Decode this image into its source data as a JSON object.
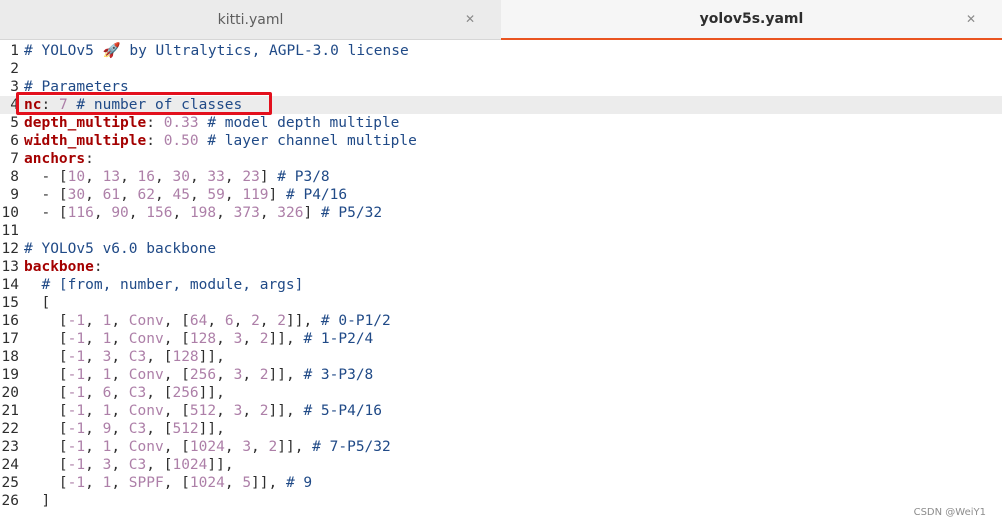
{
  "tabs": [
    {
      "label": "kitti.yaml",
      "active": false,
      "close_glyph": "✕"
    },
    {
      "label": "yolov5s.yaml",
      "active": true,
      "close_glyph": "✕"
    }
  ],
  "editor": {
    "current_line": 4,
    "highlighted_line": 4,
    "lines": [
      {
        "num": "1",
        "tokens": [
          {
            "t": "c",
            "v": "# YOLOv5 🚀 by Ultralytics, AGPL-3.0 license"
          }
        ]
      },
      {
        "num": "2",
        "tokens": []
      },
      {
        "num": "3",
        "tokens": [
          {
            "t": "c",
            "v": "# Parameters"
          }
        ]
      },
      {
        "num": "4",
        "tokens": [
          {
            "t": "k",
            "v": "nc"
          },
          {
            "t": "p",
            "v": ": "
          },
          {
            "t": "n",
            "v": "7"
          },
          {
            "t": "p",
            "v": " "
          },
          {
            "t": "c",
            "v": "# number of classes"
          }
        ]
      },
      {
        "num": "5",
        "tokens": [
          {
            "t": "k",
            "v": "depth_multiple"
          },
          {
            "t": "p",
            "v": ": "
          },
          {
            "t": "n",
            "v": "0.33"
          },
          {
            "t": "p",
            "v": " "
          },
          {
            "t": "c",
            "v": "# model depth multiple"
          }
        ]
      },
      {
        "num": "6",
        "tokens": [
          {
            "t": "k",
            "v": "width_multiple"
          },
          {
            "t": "p",
            "v": ": "
          },
          {
            "t": "n",
            "v": "0.50"
          },
          {
            "t": "p",
            "v": " "
          },
          {
            "t": "c",
            "v": "# layer channel multiple"
          }
        ]
      },
      {
        "num": "7",
        "tokens": [
          {
            "t": "k",
            "v": "anchors"
          },
          {
            "t": "p",
            "v": ":"
          }
        ]
      },
      {
        "num": "8",
        "tokens": [
          {
            "t": "p",
            "v": "  - ["
          },
          {
            "t": "n",
            "v": "10"
          },
          {
            "t": "p",
            "v": ", "
          },
          {
            "t": "n",
            "v": "13"
          },
          {
            "t": "p",
            "v": ", "
          },
          {
            "t": "n",
            "v": "16"
          },
          {
            "t": "p",
            "v": ", "
          },
          {
            "t": "n",
            "v": "30"
          },
          {
            "t": "p",
            "v": ", "
          },
          {
            "t": "n",
            "v": "33"
          },
          {
            "t": "p",
            "v": ", "
          },
          {
            "t": "n",
            "v": "23"
          },
          {
            "t": "p",
            "v": "] "
          },
          {
            "t": "c",
            "v": "# P3/8"
          }
        ]
      },
      {
        "num": "9",
        "tokens": [
          {
            "t": "p",
            "v": "  - ["
          },
          {
            "t": "n",
            "v": "30"
          },
          {
            "t": "p",
            "v": ", "
          },
          {
            "t": "n",
            "v": "61"
          },
          {
            "t": "p",
            "v": ", "
          },
          {
            "t": "n",
            "v": "62"
          },
          {
            "t": "p",
            "v": ", "
          },
          {
            "t": "n",
            "v": "45"
          },
          {
            "t": "p",
            "v": ", "
          },
          {
            "t": "n",
            "v": "59"
          },
          {
            "t": "p",
            "v": ", "
          },
          {
            "t": "n",
            "v": "119"
          },
          {
            "t": "p",
            "v": "] "
          },
          {
            "t": "c",
            "v": "# P4/16"
          }
        ]
      },
      {
        "num": "10",
        "tokens": [
          {
            "t": "p",
            "v": "  - ["
          },
          {
            "t": "n",
            "v": "116"
          },
          {
            "t": "p",
            "v": ", "
          },
          {
            "t": "n",
            "v": "90"
          },
          {
            "t": "p",
            "v": ", "
          },
          {
            "t": "n",
            "v": "156"
          },
          {
            "t": "p",
            "v": ", "
          },
          {
            "t": "n",
            "v": "198"
          },
          {
            "t": "p",
            "v": ", "
          },
          {
            "t": "n",
            "v": "373"
          },
          {
            "t": "p",
            "v": ", "
          },
          {
            "t": "n",
            "v": "326"
          },
          {
            "t": "p",
            "v": "] "
          },
          {
            "t": "c",
            "v": "# P5/32"
          }
        ]
      },
      {
        "num": "11",
        "tokens": []
      },
      {
        "num": "12",
        "tokens": [
          {
            "t": "c",
            "v": "# YOLOv5 v6.0 backbone"
          }
        ]
      },
      {
        "num": "13",
        "tokens": [
          {
            "t": "k",
            "v": "backbone"
          },
          {
            "t": "p",
            "v": ":"
          }
        ]
      },
      {
        "num": "14",
        "tokens": [
          {
            "t": "p",
            "v": "  "
          },
          {
            "t": "c",
            "v": "# [from, number, module, args]"
          }
        ]
      },
      {
        "num": "15",
        "tokens": [
          {
            "t": "p",
            "v": "  ["
          }
        ]
      },
      {
        "num": "16",
        "tokens": [
          {
            "t": "p",
            "v": "    ["
          },
          {
            "t": "n",
            "v": "-1"
          },
          {
            "t": "p",
            "v": ", "
          },
          {
            "t": "n",
            "v": "1"
          },
          {
            "t": "p",
            "v": ", "
          },
          {
            "t": "n",
            "v": "Conv"
          },
          {
            "t": "p",
            "v": ", ["
          },
          {
            "t": "n",
            "v": "64"
          },
          {
            "t": "p",
            "v": ", "
          },
          {
            "t": "n",
            "v": "6"
          },
          {
            "t": "p",
            "v": ", "
          },
          {
            "t": "n",
            "v": "2"
          },
          {
            "t": "p",
            "v": ", "
          },
          {
            "t": "n",
            "v": "2"
          },
          {
            "t": "p",
            "v": "]], "
          },
          {
            "t": "c",
            "v": "# 0-P1/2"
          }
        ]
      },
      {
        "num": "17",
        "tokens": [
          {
            "t": "p",
            "v": "    ["
          },
          {
            "t": "n",
            "v": "-1"
          },
          {
            "t": "p",
            "v": ", "
          },
          {
            "t": "n",
            "v": "1"
          },
          {
            "t": "p",
            "v": ", "
          },
          {
            "t": "n",
            "v": "Conv"
          },
          {
            "t": "p",
            "v": ", ["
          },
          {
            "t": "n",
            "v": "128"
          },
          {
            "t": "p",
            "v": ", "
          },
          {
            "t": "n",
            "v": "3"
          },
          {
            "t": "p",
            "v": ", "
          },
          {
            "t": "n",
            "v": "2"
          },
          {
            "t": "p",
            "v": "]], "
          },
          {
            "t": "c",
            "v": "# 1-P2/4"
          }
        ]
      },
      {
        "num": "18",
        "tokens": [
          {
            "t": "p",
            "v": "    ["
          },
          {
            "t": "n",
            "v": "-1"
          },
          {
            "t": "p",
            "v": ", "
          },
          {
            "t": "n",
            "v": "3"
          },
          {
            "t": "p",
            "v": ", "
          },
          {
            "t": "n",
            "v": "C3"
          },
          {
            "t": "p",
            "v": ", ["
          },
          {
            "t": "n",
            "v": "128"
          },
          {
            "t": "p",
            "v": "]],"
          }
        ]
      },
      {
        "num": "19",
        "tokens": [
          {
            "t": "p",
            "v": "    ["
          },
          {
            "t": "n",
            "v": "-1"
          },
          {
            "t": "p",
            "v": ", "
          },
          {
            "t": "n",
            "v": "1"
          },
          {
            "t": "p",
            "v": ", "
          },
          {
            "t": "n",
            "v": "Conv"
          },
          {
            "t": "p",
            "v": ", ["
          },
          {
            "t": "n",
            "v": "256"
          },
          {
            "t": "p",
            "v": ", "
          },
          {
            "t": "n",
            "v": "3"
          },
          {
            "t": "p",
            "v": ", "
          },
          {
            "t": "n",
            "v": "2"
          },
          {
            "t": "p",
            "v": "]], "
          },
          {
            "t": "c",
            "v": "# 3-P3/8"
          }
        ]
      },
      {
        "num": "20",
        "tokens": [
          {
            "t": "p",
            "v": "    ["
          },
          {
            "t": "n",
            "v": "-1"
          },
          {
            "t": "p",
            "v": ", "
          },
          {
            "t": "n",
            "v": "6"
          },
          {
            "t": "p",
            "v": ", "
          },
          {
            "t": "n",
            "v": "C3"
          },
          {
            "t": "p",
            "v": ", ["
          },
          {
            "t": "n",
            "v": "256"
          },
          {
            "t": "p",
            "v": "]],"
          }
        ]
      },
      {
        "num": "21",
        "tokens": [
          {
            "t": "p",
            "v": "    ["
          },
          {
            "t": "n",
            "v": "-1"
          },
          {
            "t": "p",
            "v": ", "
          },
          {
            "t": "n",
            "v": "1"
          },
          {
            "t": "p",
            "v": ", "
          },
          {
            "t": "n",
            "v": "Conv"
          },
          {
            "t": "p",
            "v": ", ["
          },
          {
            "t": "n",
            "v": "512"
          },
          {
            "t": "p",
            "v": ", "
          },
          {
            "t": "n",
            "v": "3"
          },
          {
            "t": "p",
            "v": ", "
          },
          {
            "t": "n",
            "v": "2"
          },
          {
            "t": "p",
            "v": "]], "
          },
          {
            "t": "c",
            "v": "# 5-P4/16"
          }
        ]
      },
      {
        "num": "22",
        "tokens": [
          {
            "t": "p",
            "v": "    ["
          },
          {
            "t": "n",
            "v": "-1"
          },
          {
            "t": "p",
            "v": ", "
          },
          {
            "t": "n",
            "v": "9"
          },
          {
            "t": "p",
            "v": ", "
          },
          {
            "t": "n",
            "v": "C3"
          },
          {
            "t": "p",
            "v": ", ["
          },
          {
            "t": "n",
            "v": "512"
          },
          {
            "t": "p",
            "v": "]],"
          }
        ]
      },
      {
        "num": "23",
        "tokens": [
          {
            "t": "p",
            "v": "    ["
          },
          {
            "t": "n",
            "v": "-1"
          },
          {
            "t": "p",
            "v": ", "
          },
          {
            "t": "n",
            "v": "1"
          },
          {
            "t": "p",
            "v": ", "
          },
          {
            "t": "n",
            "v": "Conv"
          },
          {
            "t": "p",
            "v": ", ["
          },
          {
            "t": "n",
            "v": "1024"
          },
          {
            "t": "p",
            "v": ", "
          },
          {
            "t": "n",
            "v": "3"
          },
          {
            "t": "p",
            "v": ", "
          },
          {
            "t": "n",
            "v": "2"
          },
          {
            "t": "p",
            "v": "]], "
          },
          {
            "t": "c",
            "v": "# 7-P5/32"
          }
        ]
      },
      {
        "num": "24",
        "tokens": [
          {
            "t": "p",
            "v": "    ["
          },
          {
            "t": "n",
            "v": "-1"
          },
          {
            "t": "p",
            "v": ", "
          },
          {
            "t": "n",
            "v": "3"
          },
          {
            "t": "p",
            "v": ", "
          },
          {
            "t": "n",
            "v": "C3"
          },
          {
            "t": "p",
            "v": ", ["
          },
          {
            "t": "n",
            "v": "1024"
          },
          {
            "t": "p",
            "v": "]],"
          }
        ]
      },
      {
        "num": "25",
        "tokens": [
          {
            "t": "p",
            "v": "    ["
          },
          {
            "t": "n",
            "v": "-1"
          },
          {
            "t": "p",
            "v": ", "
          },
          {
            "t": "n",
            "v": "1"
          },
          {
            "t": "p",
            "v": ", "
          },
          {
            "t": "n",
            "v": "SPPF"
          },
          {
            "t": "p",
            "v": ", ["
          },
          {
            "t": "n",
            "v": "1024"
          },
          {
            "t": "p",
            "v": ", "
          },
          {
            "t": "n",
            "v": "5"
          },
          {
            "t": "p",
            "v": "]], "
          },
          {
            "t": "c",
            "v": "# 9"
          }
        ]
      },
      {
        "num": "26",
        "tokens": [
          {
            "t": "p",
            "v": "  ]"
          }
        ]
      }
    ]
  },
  "watermark": "CSDN @WeiY1",
  "colors": {
    "keyword": "#a40000",
    "number": "#ad7fa8",
    "comment": "#204a87",
    "highlight_box": "#e3101d",
    "active_tab_underline": "#e95420"
  }
}
